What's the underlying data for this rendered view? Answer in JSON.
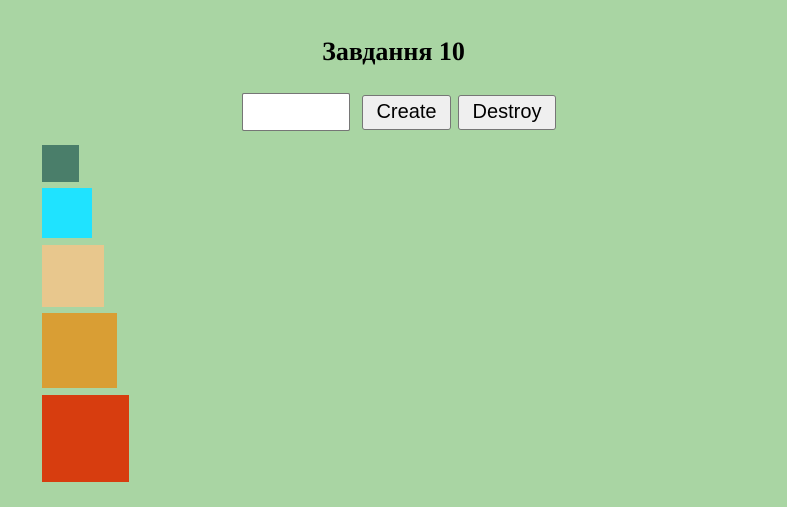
{
  "page": {
    "title": "Завдання 10"
  },
  "controls": {
    "amount_value": "",
    "create_label": "Create",
    "destroy_label": "Destroy"
  },
  "boxes": [
    {
      "color": "#4a7e6a"
    },
    {
      "color": "#1fe3ff"
    },
    {
      "color": "#e8c78d"
    },
    {
      "color": "#d99e34"
    },
    {
      "color": "#d73d0f"
    }
  ]
}
